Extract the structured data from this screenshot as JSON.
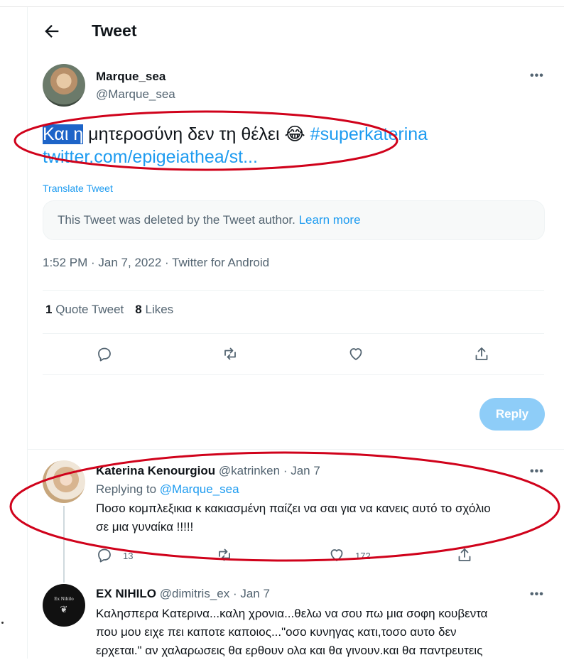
{
  "header": {
    "title": "Tweet"
  },
  "tweet": {
    "author_name": "Marque_sea",
    "author_handle": "@Marque_sea",
    "text_highlight": "Και η",
    "text_rest": " μητεροσύνη δεν τη θέλει 😂 ",
    "hashtag": "#superkaterina",
    "link": "twitter.com/epigeiathea/st...",
    "translate": "Translate Tweet",
    "deleted_notice": "This Tweet was deleted by the Tweet author.",
    "learn_more": "Learn more",
    "timestamp": "1:52 PM · Jan 7, 2022 · Twitter for Android",
    "quote_count": "1",
    "quote_label": "Quote Tweet",
    "likes_count": "8",
    "likes_label": "Likes"
  },
  "reply_button": "Reply",
  "replies": [
    {
      "name": "Katerina Kenourgiou",
      "handle_date": "@katrinken · Jan 7",
      "replying_prefix": "Replying to",
      "replying_to": "@Marque_sea",
      "line1": "Ποσο κομπλεξικια κ κακιασμένη παίζει να σαι για να κανεις αυτό το σχόλιο",
      "line2": "σε μια γυναίκα !!!!!",
      "reply_count": "13",
      "like_count": "172"
    },
    {
      "name": "EX NIHILO",
      "handle_date": "@dimitris_ex · Jan 7",
      "avatar_text": "Ex Nihilo",
      "line1": "Καλησπερα Κατερινα...καλη χρονια...θελω να σου πω μια σοφη κουβεντα",
      "line2": "που μου ειχε πει καποτε καποιος...\"οσο κυνηγας κατι,τοσο αυτο δεν",
      "line3": "ερχεται.\" αν χαλαρωσεις θα ερθουν ολα και θα γινουν.και θα παντρευτεις"
    }
  ],
  "annotation_color": "#d0021b"
}
